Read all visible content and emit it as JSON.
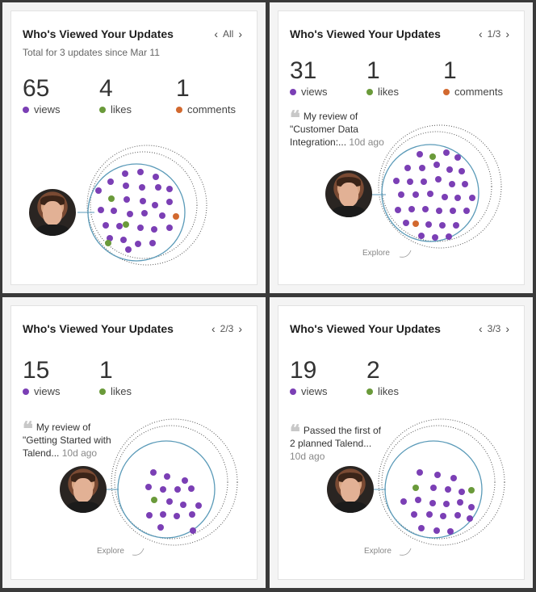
{
  "colors": {
    "views": "#7b3fb5",
    "likes": "#6a9a3a",
    "comments": "#d2692f",
    "ring": "#5a9ab8"
  },
  "panels": [
    {
      "title": "Who's Viewed Your Updates",
      "nav": {
        "prev": "‹",
        "label": "All",
        "next": "›"
      },
      "subtitle": "Total for 3 updates since Mar 11",
      "stats": [
        {
          "num": "65",
          "label": "views",
          "color": "views"
        },
        {
          "num": "4",
          "label": "likes",
          "color": "likes"
        },
        {
          "num": "1",
          "label": "comments",
          "color": "comments"
        }
      ]
    },
    {
      "title": "Who's Viewed Your Updates",
      "nav": {
        "prev": "‹",
        "label": "1/3",
        "next": "›"
      },
      "stats": [
        {
          "num": "31",
          "label": "views",
          "color": "views"
        },
        {
          "num": "1",
          "label": "likes",
          "color": "likes"
        },
        {
          "num": "1",
          "label": "comments",
          "color": "comments"
        }
      ],
      "quote": {
        "text": "My review of \"Customer Data Integration:...",
        "ago": "10d ago"
      },
      "explore": "Explore"
    },
    {
      "title": "Who's Viewed Your Updates",
      "nav": {
        "prev": "‹",
        "label": "2/3",
        "next": "›"
      },
      "stats": [
        {
          "num": "15",
          "label": "views",
          "color": "views"
        },
        {
          "num": "1",
          "label": "likes",
          "color": "likes"
        }
      ],
      "quote": {
        "text": "My review of \"Getting Started with Talend...",
        "ago": "10d ago"
      },
      "explore": "Explore"
    },
    {
      "title": "Who's Viewed Your Updates",
      "nav": {
        "prev": "‹",
        "label": "3/3",
        "next": "›"
      },
      "stats": [
        {
          "num": "19",
          "label": "views",
          "color": "views"
        },
        {
          "num": "2",
          "label": "likes",
          "color": "likes"
        }
      ],
      "quote": {
        "text": "Passed the first of 2 planned Talend...",
        "ago": "10d ago"
      },
      "explore": "Explore"
    }
  ]
}
